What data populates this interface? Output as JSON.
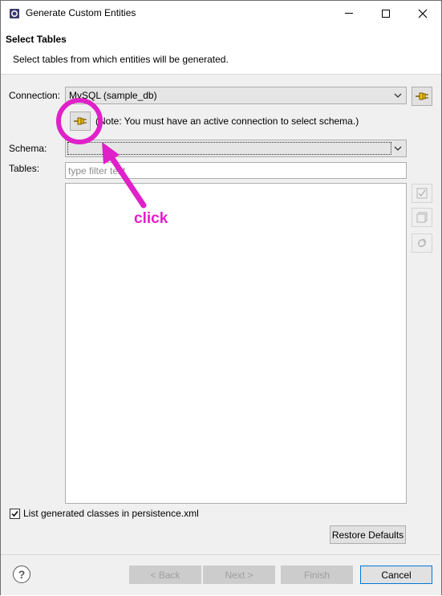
{
  "window": {
    "title": "Generate Custom Entities",
    "controls": [
      "minimize-icon",
      "maximize-icon",
      "close-icon"
    ]
  },
  "header": {
    "title": "Select Tables",
    "description": "Select tables from which entities will be generated."
  },
  "form": {
    "connection_label": "Connection:",
    "connection_value": "MySQL (sample_db)",
    "note": "(Note: You must have an active connection to select schema.)",
    "schema_label": "Schema:",
    "schema_value": "",
    "tables_label": "Tables:",
    "filter_placeholder": "type filter text",
    "list_items": [],
    "side_buttons": [
      "select-all-icon",
      "deselect-all-icon",
      "refresh-icon"
    ],
    "list_classes_checkbox": {
      "label": "List generated classes in persistence.xml",
      "checked": true
    },
    "restore_defaults": "Restore Defaults"
  },
  "footer": {
    "back": "< Back",
    "next": "Next >",
    "finish": "Finish",
    "cancel": "Cancel",
    "help_icon": "help-icon"
  },
  "annotation": {
    "text": "click",
    "color": "#e020c8"
  }
}
